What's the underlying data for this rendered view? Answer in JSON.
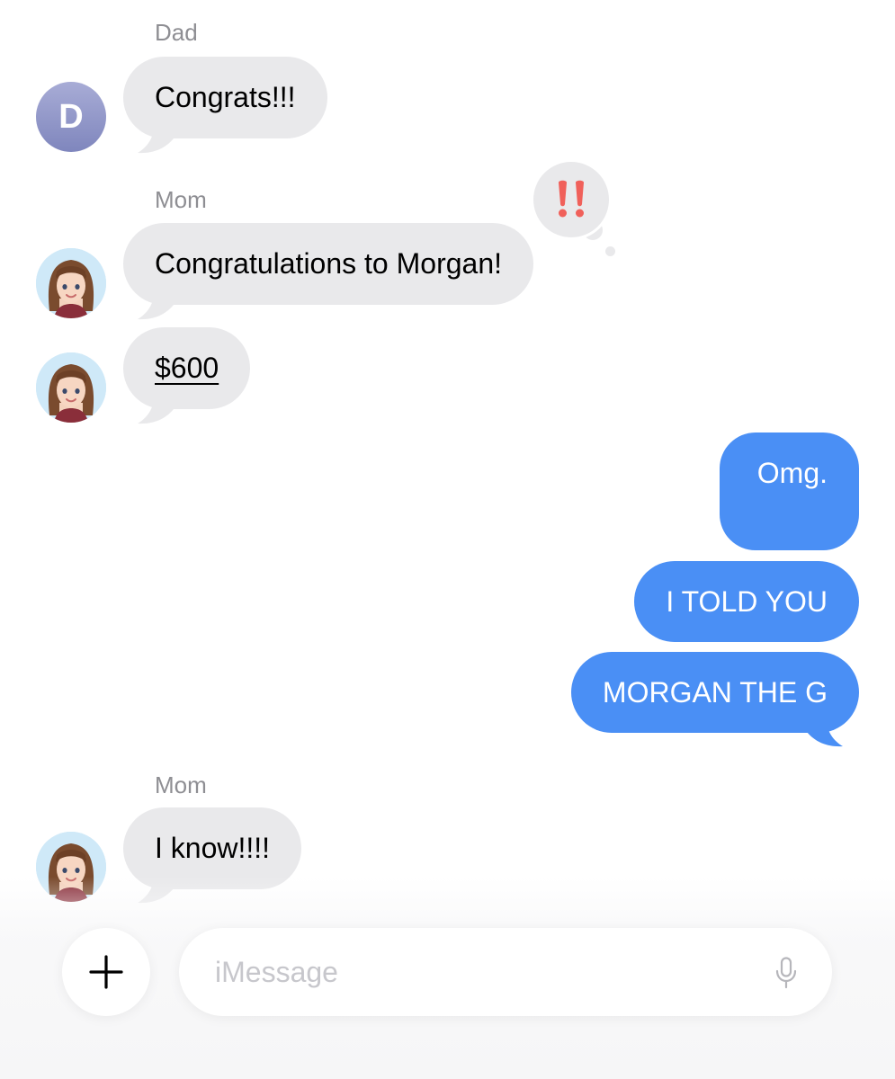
{
  "messages": [
    {
      "sender": "Dad",
      "avatar_initial": "D",
      "text": "Congrats!!!"
    },
    {
      "sender": "Mom",
      "text": "Congratulations to Morgan!",
      "reaction": "‼️"
    },
    {
      "text": "$600"
    },
    {
      "text": "Omg."
    },
    {
      "text": "I TOLD YOU"
    },
    {
      "text": "MORGAN THE G"
    },
    {
      "sender": "Mom",
      "text": "I know!!!!"
    }
  ],
  "compose": {
    "placeholder": "iMessage"
  },
  "icons": {
    "add": "plus-icon",
    "microphone": "microphone-icon",
    "reaction": "double-exclamation-icon"
  },
  "colors": {
    "incoming_bubble": "#e9e9eb",
    "outgoing_bubble": "#4a8ff5",
    "sender_name": "#8e8e93",
    "reaction_red": "#f0605a"
  }
}
